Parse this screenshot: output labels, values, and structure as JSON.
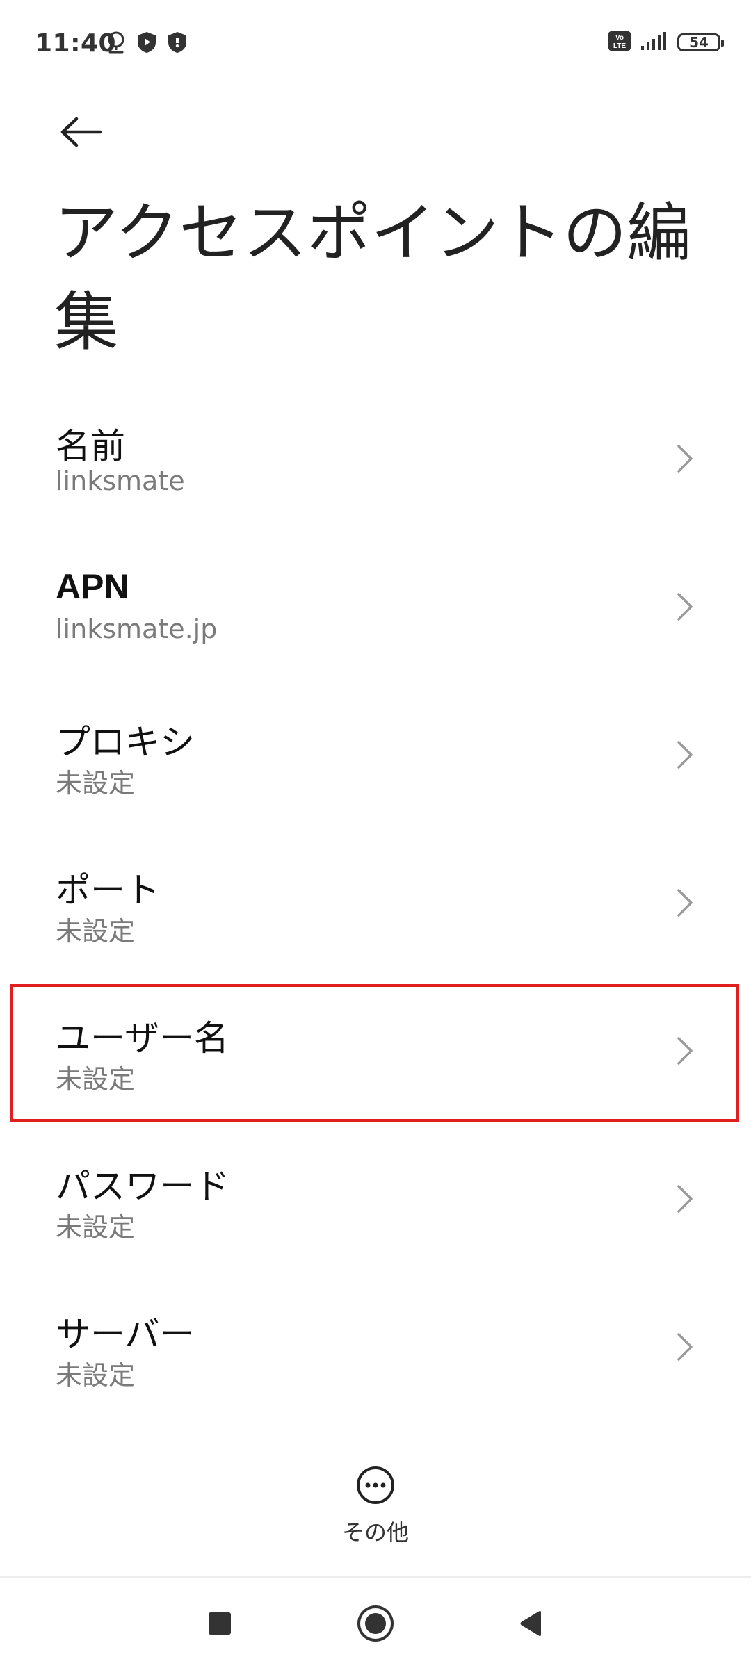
{
  "status_bar": {
    "time": "11:40",
    "battery": "54",
    "icons_left": [
      "location-icon",
      "play-shield-icon",
      "security-shield-icon"
    ],
    "icons_right": [
      "volte-icon",
      "signal-icon",
      "battery-icon"
    ]
  },
  "header": {
    "back_icon": "arrow-left-icon",
    "title": "アクセスポイントの編集"
  },
  "items": [
    {
      "title": "名前",
      "value": "linksmate"
    },
    {
      "title": "APN",
      "value": "linksmate.jp"
    },
    {
      "title": "プロキシ",
      "value": "未設定"
    },
    {
      "title": "ポート",
      "value": "未設定"
    },
    {
      "title": "ユーザー名",
      "value": "未設定"
    },
    {
      "title": "パスワード",
      "value": "未設定"
    },
    {
      "title": "サーバー",
      "value": "未設定"
    }
  ],
  "highlighted_item": "ユーザー名",
  "more": {
    "icon": "more-horizontal-icon",
    "label": "その他"
  },
  "nav": {
    "recents_icon": "square-icon",
    "home_icon": "circle-icon",
    "back_icon": "triangle-back-icon"
  },
  "colors": {
    "highlight": "#e02020",
    "secondary_text": "#7a7a7a"
  }
}
